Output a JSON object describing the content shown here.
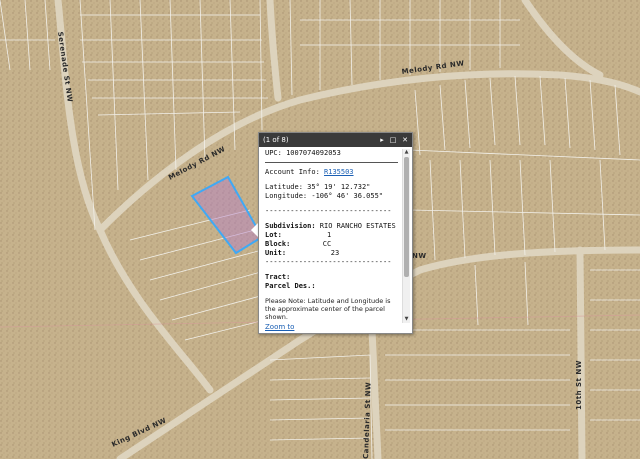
{
  "map": {
    "colors": {
      "terrain": "#c4b08a",
      "terrain_dark": "#b49c74",
      "road": "#ddd3bd",
      "parcel_line": "#f2f0ea",
      "selected_outline": "#3fa9f5",
      "selected_fill": "#b27bc8"
    },
    "road_labels": {
      "serenade": "Serenade St NW",
      "melody_top": "Melody Rd NW",
      "melody_left": "Melody Rd NW",
      "king_blvd": "King Blvd NW",
      "candelaria": "Candelaria St NW",
      "right_road": "NW",
      "tenth_st": "10th St NW"
    }
  },
  "popup": {
    "title": "(1 of 8)",
    "controls": {
      "next_icon": "▸",
      "maximize_icon": "□",
      "close_icon": "✕"
    },
    "upc_label": "UPC:",
    "upc_value": "1007074092053",
    "account_label": "Account Info:",
    "account_value": "R135503",
    "latitude_label": "Latitude:",
    "latitude_value": "35° 19' 12.732\"",
    "longitude_label": "Longitude:",
    "longitude_value": "-106° 46' 36.055\"",
    "dash_line": "------------------------------",
    "subdivision_label": "Subdivision:",
    "subdivision_value": "RIO RANCHO ESTATES",
    "lot_label": "Lot:",
    "lot_value": "1",
    "block_label": "Block:",
    "block_value": "CC",
    "unit_label": "Unit:",
    "unit_value": "23",
    "tract_label": "Tract:",
    "parcel_des_label": "Parcel Des.:",
    "note": "Please Note: Latitude and Longitude is the approximate center of the parcel shown.",
    "zoom_link": "Zoom to"
  }
}
